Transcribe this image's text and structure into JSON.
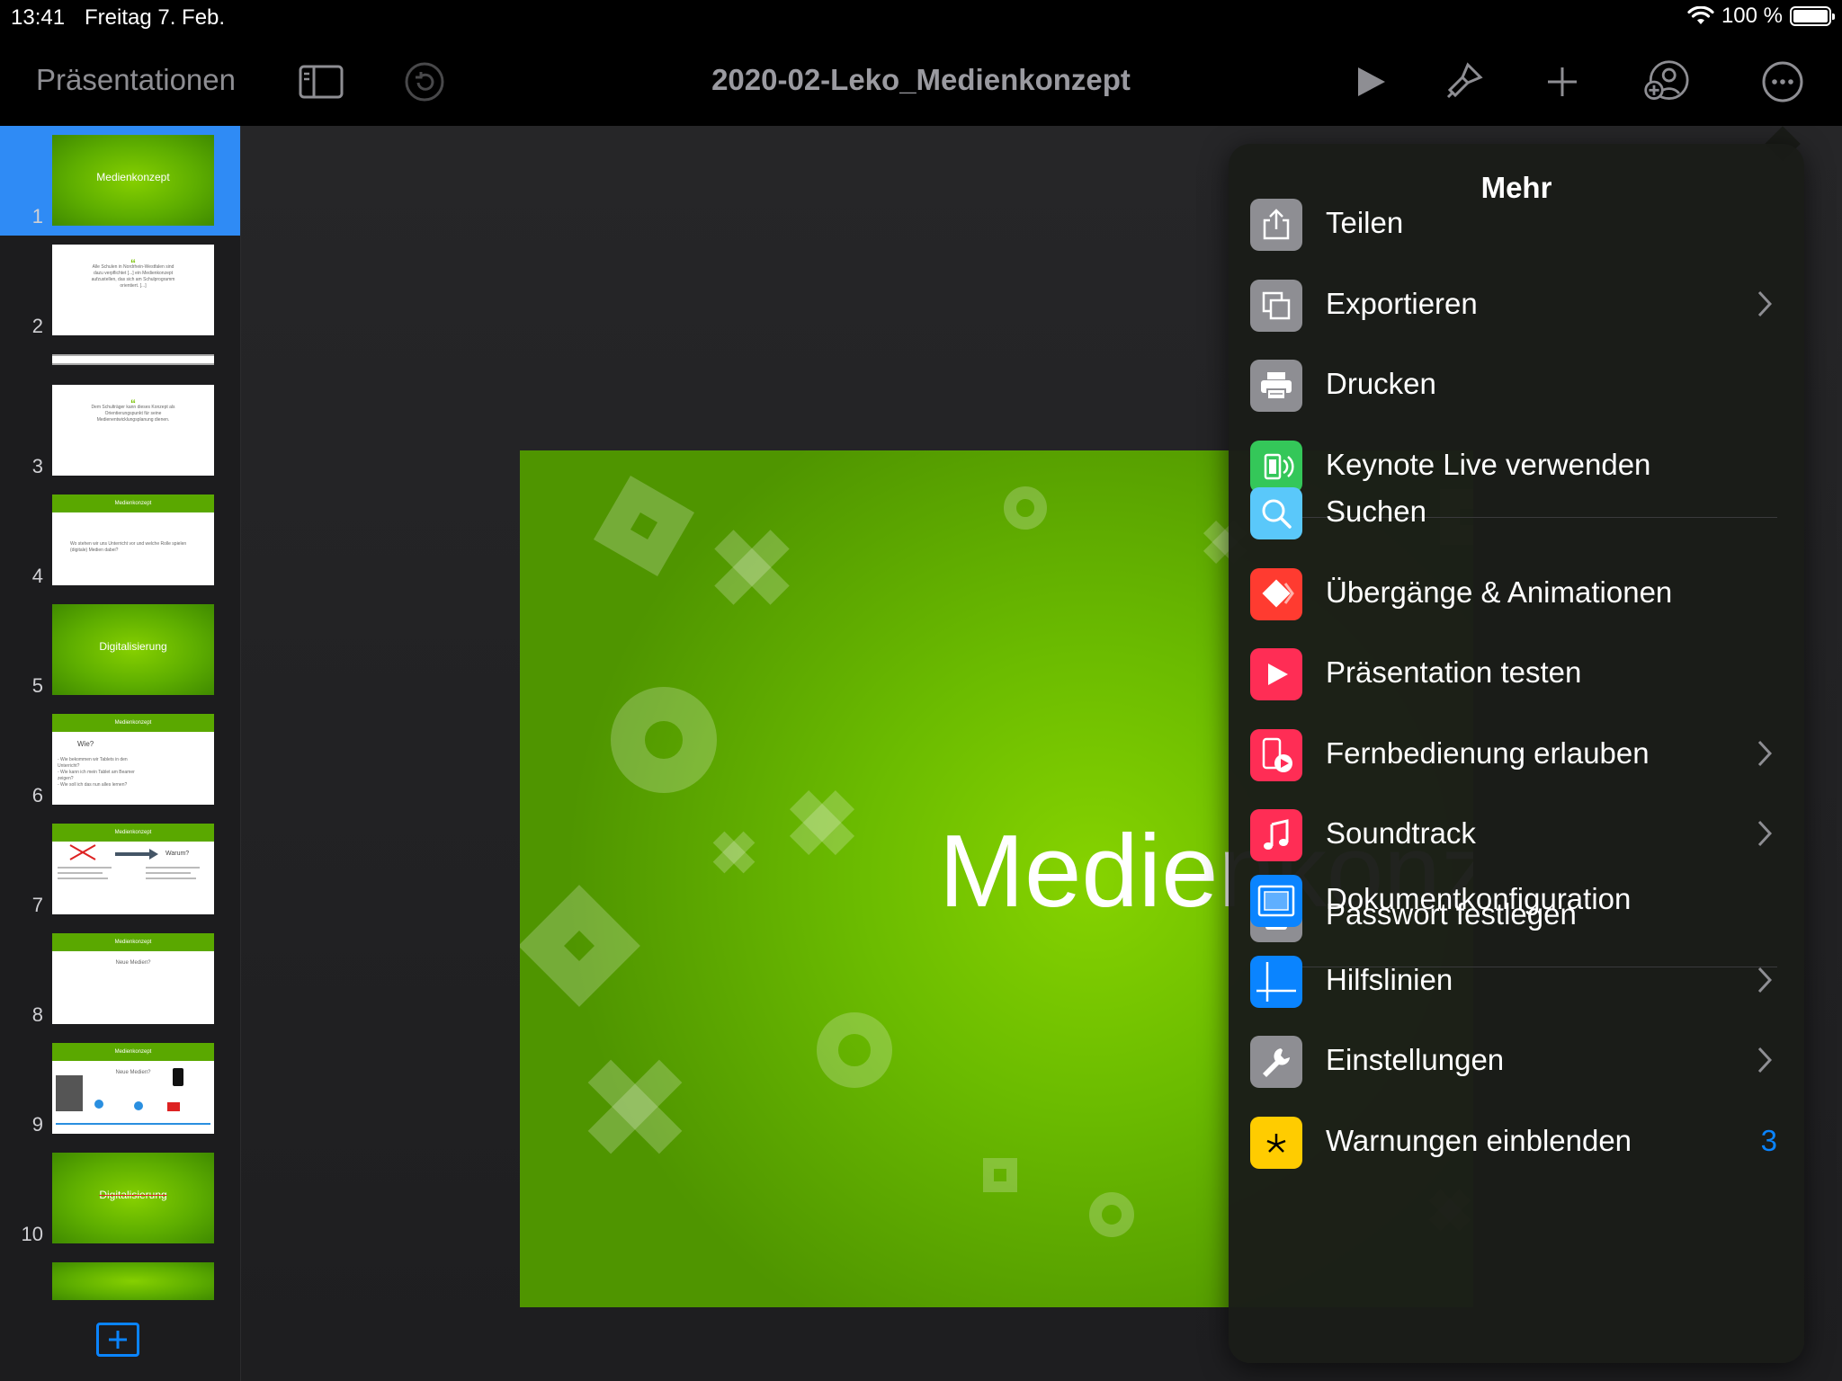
{
  "status_bar": {
    "time": "13:41",
    "date": "Freitag 7. Feb.",
    "battery": "100 %"
  },
  "toolbar": {
    "back_label": "Präsentationen",
    "document_title": "2020-02-Leko_Medienkonzept"
  },
  "slides": [
    {
      "number": "1",
      "style": "green-title",
      "title": "Medienkonzept",
      "selected": true
    },
    {
      "number": "2",
      "style": "quote",
      "text": "Alle Schulen in Nordrhein-Westfalen sind dazu verpflichtet [...] ein Medienkonzept aufzustellen, das sich am Schulprogramm orientiert. [...]"
    },
    {
      "number": "3",
      "style": "quote",
      "text": "Dem Schulträger kann dieses Konzept als Orientierungspunkt für seine Medienentwicklungsplanung dienen."
    },
    {
      "number": "4",
      "style": "band",
      "band": "Medienkonzept",
      "text": "Wo stehen wir uns Unterricht vor und welche Rolle spielen (digitale) Medien dabei?"
    },
    {
      "number": "5",
      "style": "green-title",
      "title": "Digitalisierung"
    },
    {
      "number": "6",
      "style": "band",
      "band": "Medienkonzept",
      "heading": "Wie?",
      "text": "- Wie bekommen wir Tablets in den Unterricht?\n- Wie kann ich mein Tablet am Beamer zeigen?\n- Wie soll ich das nun alles lernen?"
    },
    {
      "number": "7",
      "style": "band",
      "band": "Medienkonzept",
      "heading": "Warum?"
    },
    {
      "number": "8",
      "style": "band",
      "band": "Medienkonzept",
      "heading": "Neue Medien?"
    },
    {
      "number": "9",
      "style": "band",
      "band": "Medienkonzept",
      "heading": "Neue Medien?"
    },
    {
      "number": "10",
      "style": "green-title",
      "title": "Digitalisierung"
    }
  ],
  "slide_canvas": {
    "title": "Medienkonz"
  },
  "more_menu": {
    "title": "Mehr",
    "groups": [
      [
        {
          "label": "Teilen",
          "icon": "share-icon",
          "color": "#8e8e93",
          "chevron": false
        },
        {
          "label": "Exportieren",
          "icon": "export-icon",
          "color": "#8e8e93",
          "chevron": true
        },
        {
          "label": "Drucken",
          "icon": "printer-icon",
          "color": "#8e8e93",
          "chevron": false
        },
        {
          "label": "Keynote Live verwenden",
          "icon": "keynote-live-icon",
          "color": "#34c759",
          "chevron": false
        }
      ],
      [
        {
          "label": "Suchen",
          "icon": "search-icon",
          "color": "#5ac8fa",
          "chevron": false
        },
        {
          "label": "Übergänge & Animationen",
          "icon": "transitions-icon",
          "color": "#ff3b30",
          "chevron": false
        },
        {
          "label": "Präsentation testen",
          "icon": "play-icon",
          "color": "#ff2d55",
          "chevron": false
        },
        {
          "label": "Fernbedienung erlauben",
          "icon": "remote-icon",
          "color": "#ff2d55",
          "chevron": true
        },
        {
          "label": "Soundtrack",
          "icon": "music-note-icon",
          "color": "#ff2d55",
          "chevron": true
        },
        {
          "label": "Passwort festlegen",
          "icon": "lock-icon",
          "color": "#8e8e93",
          "chevron": false
        }
      ],
      [
        {
          "label": "Dokumentkonfiguration",
          "icon": "document-setup-icon",
          "color": "#0a84ff",
          "chevron": false
        },
        {
          "label": "Hilfslinien",
          "icon": "guides-icon",
          "color": "#0a84ff",
          "chevron": true
        },
        {
          "label": "Einstellungen",
          "icon": "wrench-icon",
          "color": "#8e8e93",
          "chevron": true
        },
        {
          "label": "Warnungen einblenden",
          "icon": "warning-icon",
          "color": "#ffcc00",
          "chevron": false,
          "badge": "3"
        }
      ]
    ]
  }
}
